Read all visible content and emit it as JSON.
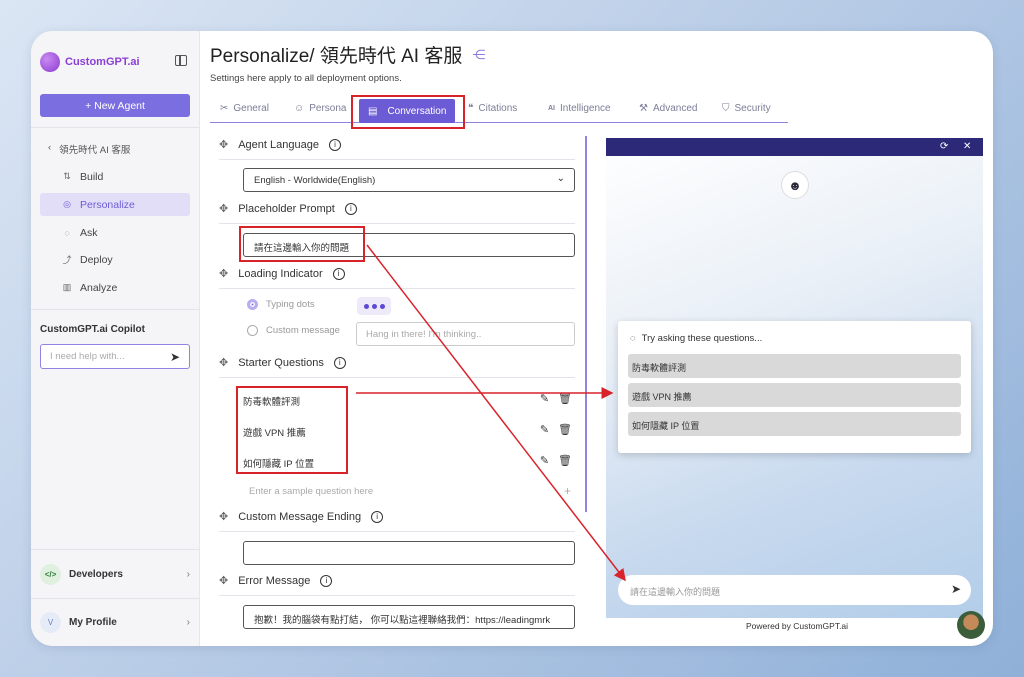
{
  "sidebar": {
    "brand": "CustomGPT.ai",
    "new_agent": "+ New Agent",
    "back_label": "領先時代 AI 客服",
    "items": [
      {
        "icon": "build-icon",
        "label": "Build"
      },
      {
        "icon": "personalize-icon",
        "label": "Personalize"
      },
      {
        "icon": "ask-icon",
        "label": "Ask"
      },
      {
        "icon": "deploy-icon",
        "label": "Deploy"
      },
      {
        "icon": "analyze-icon",
        "label": "Analyze"
      }
    ],
    "copilot_title": "CustomGPT.ai Copilot",
    "copilot_placeholder": "I need help with...",
    "developers": "Developers",
    "profile": "My Profile",
    "profile_initial": "V"
  },
  "header": {
    "title": "Personalize/ 領先時代 AI 客服",
    "subtitle": "Settings here apply to all deployment options."
  },
  "tabs": [
    "General",
    "Persona",
    "Conversation",
    "Citations",
    "Intelligence",
    "Advanced",
    "Security"
  ],
  "settings": {
    "agent_language": {
      "label": "Agent Language",
      "value": "English - Worldwide(English)"
    },
    "placeholder_prompt": {
      "label": "Placeholder Prompt",
      "value": "請在這邊輸入你的問題"
    },
    "loading_indicator": {
      "label": "Loading Indicator",
      "typing_dots": "Typing dots",
      "custom_message": "Custom message",
      "custom_placeholder": "Hang in there! I'm thinking.."
    },
    "starter_questions": {
      "label": "Starter Questions",
      "items": [
        "防毒軟體評測",
        "遊戲 VPN 推薦",
        "如何隱藏 IP 位置"
      ],
      "placeholder": "Enter a sample question here"
    },
    "custom_message_ending": {
      "label": "Custom Message Ending",
      "value": ""
    },
    "error_message": {
      "label": "Error Message",
      "value": "抱歉！我的腦袋有點打結， 你可以點這裡聯絡我們：https://leadingmrk"
    }
  },
  "preview": {
    "suggestions_title": "Try asking these questions...",
    "suggestions": [
      "防毒軟體評測",
      "遊戲 VPN 推薦",
      "如何隱藏 IP 位置"
    ],
    "input_placeholder": "請在這邊輸入你的問題",
    "powered_by": "Powered by CustomGPT.ai"
  },
  "colors": {
    "accent": "#6b5cd6",
    "highlight": "#d8232a",
    "preview_bar": "#2c2a78"
  }
}
